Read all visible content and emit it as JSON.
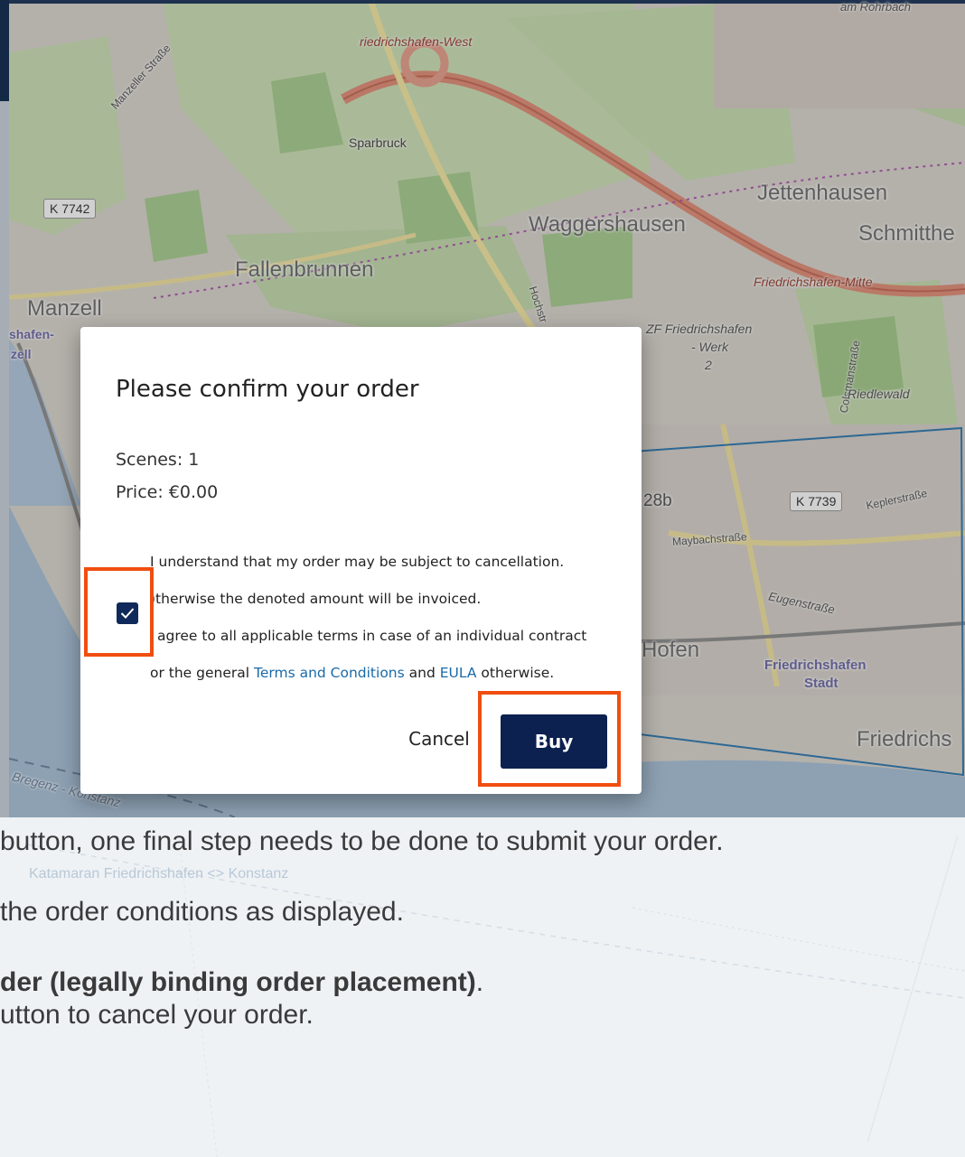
{
  "map": {
    "labels": {
      "friedrichshafen_west": "riedrichshafen-West",
      "manzeller_strasse": "Manzeller Straße",
      "sparbruck": "Sparbruck",
      "jettenhausen": "Jettenhausen",
      "waggershausen": "Waggershausen",
      "schmitthe": "Schmitthe",
      "fallenbrunnen": "Fallenbrunnen",
      "friedrichshafen_mitte": "Friedrichshafen-Mitte",
      "manzell": "Manzell",
      "shafen": "shafen-",
      "zell": "zell",
      "zf_werk": "ZF Friedrichshafen",
      "zf_werk_2": "- Werk",
      "zf_werk_3": "2",
      "hochstr": "Hochstr",
      "colsmanstrasse": "Colsmanstraße",
      "riedlewald": "Riedlewald",
      "keplerstrasse": "Keplerstraße",
      "maybachstrasse": "Maybachstraße",
      "eugenstrasse": "Eugenstraße",
      "hofen": "Hofen",
      "fh_stadt": "Friedrichshafen",
      "fh_stadt_2": "Stadt",
      "friedrichs": "Friedrichs",
      "bregenz": "Bregenz - Konstanz",
      "am_rohrbach": "am Rohrbach",
      "b28b": "28b"
    },
    "badges": {
      "k7742": "K 7742",
      "k7739": "K 7739"
    }
  },
  "dialog": {
    "title": "Please confirm your order",
    "scenes": "Scenes: 1",
    "price": "Price: €0.00",
    "terms_line1": "I understand that my order may be subject to cancellation.",
    "terms_line2": ")therwise the denoted amount will be invoiced.",
    "terms_line3": "agree to all applicable terms in case of an individual contract",
    "terms_line4_pre": "or the general ",
    "terms_link": "Terms and Conditions",
    "terms_line4_mid": " and ",
    "eula_link": "EULA",
    "terms_line4_post": " otherwise.",
    "checkbox_checked": true,
    "cancel_label": "Cancel",
    "buy_label": "Buy"
  },
  "highlight_color": "#f04e10",
  "instructions": {
    "faint_map_text": "Katamaran Friedrichshafen <> Konstanz",
    "line1": "button, one final step needs to be done to submit your order.",
    "line2": "the order conditions as displayed.",
    "line3_bold": "der (legally binding order placement)",
    "line3_tail": ".",
    "line4": "utton to cancel your order."
  }
}
